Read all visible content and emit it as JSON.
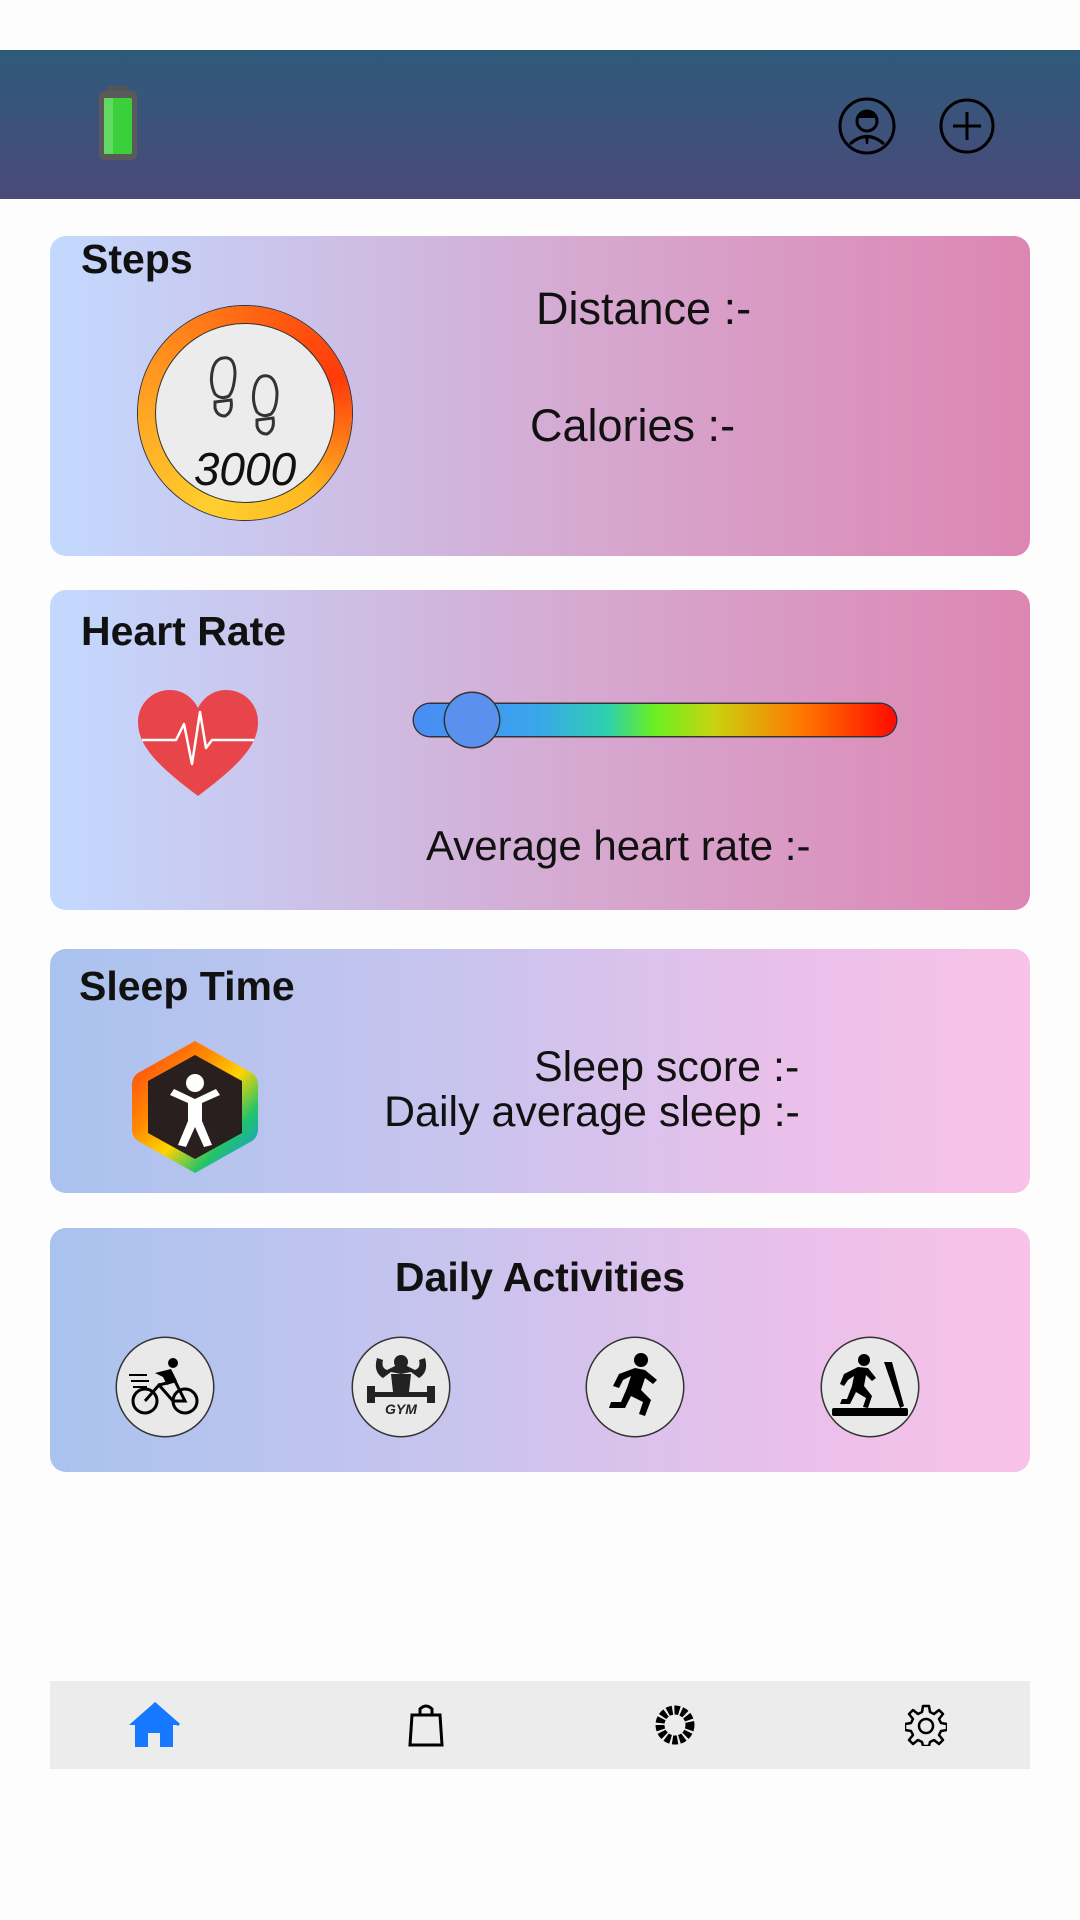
{
  "header": {
    "battery_icon": "battery-icon",
    "profile_icon": "user-profile-icon",
    "add_icon": "plus-circle-icon"
  },
  "steps": {
    "title": "Steps",
    "count": "3000",
    "distance_label": "Distance :-",
    "calories_label": "Calories :-"
  },
  "heart_rate": {
    "title": "Heart Rate",
    "average_label": "Average heart rate :-",
    "slider_level": 0.12
  },
  "sleep": {
    "title": "Sleep Time",
    "score_label": "Sleep score :-",
    "average_label": "Daily average sleep :-"
  },
  "activities": {
    "title": "Daily Activities",
    "items": [
      {
        "icon": "cycling-icon"
      },
      {
        "icon": "gym-icon",
        "text": "GYM"
      },
      {
        "icon": "running-icon"
      },
      {
        "icon": "treadmill-icon"
      }
    ]
  },
  "bottom_nav": {
    "items": [
      {
        "icon": "home-icon",
        "active": true
      },
      {
        "icon": "shopping-bag-icon"
      },
      {
        "icon": "ring-icon"
      },
      {
        "icon": "gear-icon"
      }
    ],
    "active_color": "#1677ff"
  }
}
